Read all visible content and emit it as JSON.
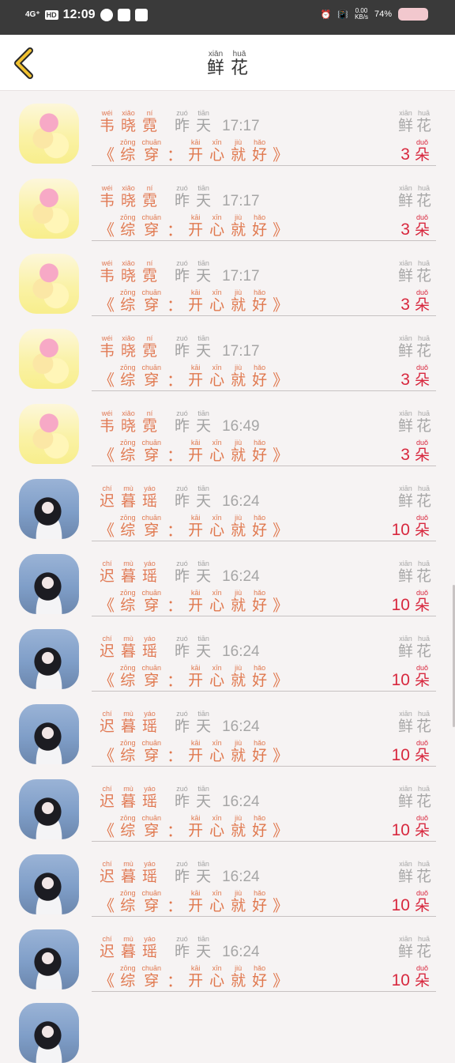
{
  "status_bar": {
    "network": "4G⁺",
    "hd": "HD",
    "time": "12:09",
    "speed_value": "0.00",
    "speed_unit": "KB/s",
    "battery": "74%"
  },
  "header": {
    "title": [
      {
        "py": "xiān",
        "hz": "鲜"
      },
      {
        "py": "huā",
        "hz": "花"
      }
    ]
  },
  "labels": {
    "yesterday": [
      {
        "py": "zuó",
        "hz": "昨"
      },
      {
        "py": "tiān",
        "hz": "天"
      }
    ],
    "flower": [
      {
        "py": "xiān",
        "hz": "鲜"
      },
      {
        "py": "huā",
        "hz": "花"
      }
    ],
    "unit": {
      "py": "duǒ",
      "hz": "朵"
    },
    "quote_open": "《",
    "quote_close": "》",
    "book_a": [
      {
        "py": "zōng",
        "hz": "综"
      },
      {
        "py": "chuān",
        "hz": "穿"
      }
    ],
    "colon": "：",
    "book_b": [
      {
        "py": "kāi",
        "hz": "开"
      },
      {
        "py": "xīn",
        "hz": "心"
      },
      {
        "py": "jiù",
        "hz": "就"
      },
      {
        "py": "hǎo",
        "hz": "好"
      }
    ]
  },
  "users": {
    "wei": [
      {
        "py": "wéi",
        "hz": "韦"
      },
      {
        "py": "xiǎo",
        "hz": "晓"
      },
      {
        "py": "ní",
        "hz": "霓"
      }
    ],
    "chi": [
      {
        "py": "chí",
        "hz": "迟"
      },
      {
        "py": "mù",
        "hz": "暮"
      },
      {
        "py": "yáo",
        "hz": "瑶"
      }
    ]
  },
  "rows": [
    {
      "user": "wei",
      "avatar": "anime-girl-avatar",
      "time": "17:17",
      "count": "3"
    },
    {
      "user": "wei",
      "avatar": "anime-girl-avatar",
      "time": "17:17",
      "count": "3"
    },
    {
      "user": "wei",
      "avatar": "anime-girl-avatar",
      "time": "17:17",
      "count": "3"
    },
    {
      "user": "wei",
      "avatar": "anime-girl-avatar",
      "time": "17:17",
      "count": "3"
    },
    {
      "user": "wei",
      "avatar": "anime-girl-avatar",
      "time": "16:49",
      "count": "3"
    },
    {
      "user": "chi",
      "avatar": "photo-avatar",
      "time": "16:24",
      "count": "10"
    },
    {
      "user": "chi",
      "avatar": "photo-avatar",
      "time": "16:24",
      "count": "10"
    },
    {
      "user": "chi",
      "avatar": "photo-avatar",
      "time": "16:24",
      "count": "10"
    },
    {
      "user": "chi",
      "avatar": "photo-avatar",
      "time": "16:24",
      "count": "10"
    },
    {
      "user": "chi",
      "avatar": "photo-avatar",
      "time": "16:24",
      "count": "10"
    },
    {
      "user": "chi",
      "avatar": "photo-avatar",
      "time": "16:24",
      "count": "10"
    },
    {
      "user": "chi",
      "avatar": "photo-avatar",
      "time": "16:24",
      "count": "10"
    }
  ],
  "colors": {
    "name": "#e17b56",
    "count": "#d8283e",
    "muted": "#a7a7a7",
    "back_icon": "#f2c230"
  }
}
